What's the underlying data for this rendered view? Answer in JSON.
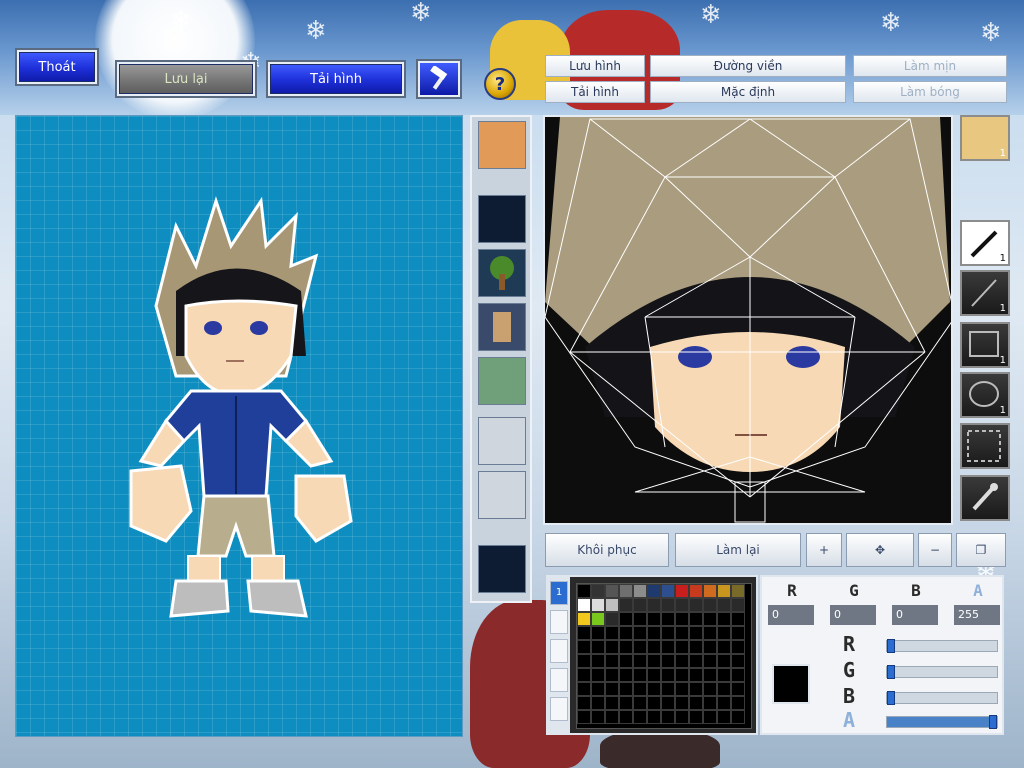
{
  "toolbar": {
    "exit_label": "Thoát",
    "save_label": "Lưu lại",
    "reload_label": "Tải hình"
  },
  "editor_tabs": {
    "save_image": "Lưu hình",
    "outline": "Đường viền",
    "smooth": "Làm mịn",
    "load_image": "Tải hình",
    "default": "Mặc định",
    "shading": "Làm bóng"
  },
  "actions": {
    "restore": "Khôi phục",
    "redo": "Làm lại"
  },
  "tools": {
    "face_count": "1",
    "pen_size": "1",
    "line_size": "1",
    "rect_size": "1",
    "ellipse_size": "1"
  },
  "color": {
    "channels": [
      {
        "label": "R",
        "value": "0"
      },
      {
        "label": "G",
        "value": "0"
      },
      {
        "label": "B",
        "value": "0"
      },
      {
        "label": "A",
        "value": "255"
      }
    ],
    "sliders": [
      {
        "label": "R",
        "value": 0
      },
      {
        "label": "G",
        "value": 0
      },
      {
        "label": "B",
        "value": 0
      },
      {
        "label": "A",
        "value": 255
      }
    ],
    "palette_tab": "1"
  },
  "palette_colors": [
    "#000000",
    "#333333",
    "#555555",
    "#6f6f6f",
    "#8c8c8c",
    "#1f3a6e",
    "#2e4f8f",
    "#c81e1e",
    "#c83a1e",
    "#d06a1e",
    "#c8961e",
    "#7a6a2a",
    "#ffffff",
    "#dcdcdc",
    "#bfbfbf",
    "#2a2a2a",
    "#2a2a2a",
    "#2a2a2a",
    "#2a2a2a",
    "#2a2a2a",
    "#2a2a2a",
    "#2a2a2a",
    "#2a2a2a",
    "#2a2a2a",
    "#f0c81e",
    "#7ac81e",
    "#2a2a2a"
  ]
}
